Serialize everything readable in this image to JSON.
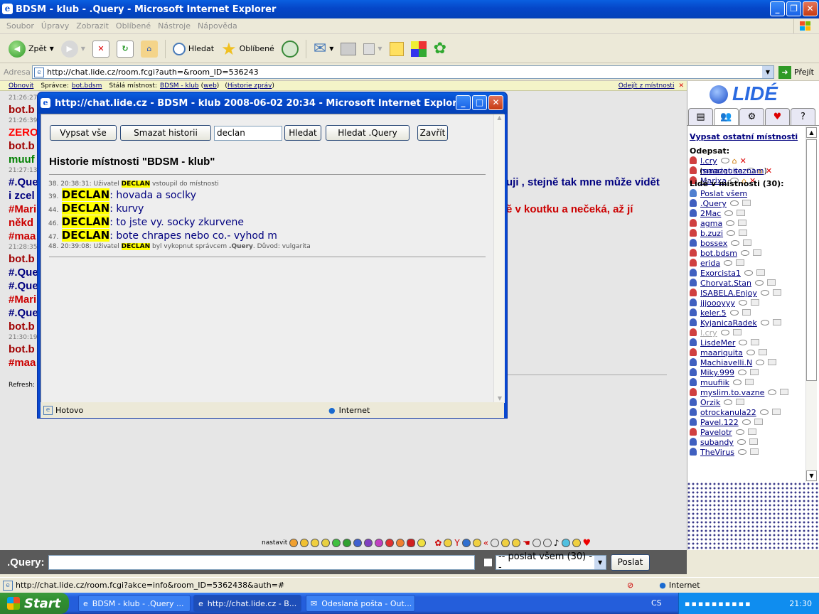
{
  "window": {
    "title": "BDSM - klub - .Query - Microsoft Internet Explorer"
  },
  "menu": [
    "Soubor",
    "Úpravy",
    "Zobrazit",
    "Oblíbené",
    "Nástroje",
    "Nápověda"
  ],
  "toolbar": {
    "back": "Zpět",
    "search": "Hledat",
    "favorites": "Oblíbené"
  },
  "address": {
    "label": "Adresa",
    "url": "http://chat.lide.cz/room.fcgi?auth=&room_ID=536243",
    "go": "Přejít"
  },
  "room_bar": {
    "refresh": "Obnovit",
    "admin_label": "Správce:",
    "admin": "bot.bdsm",
    "room_label": "Stálá místnost:",
    "room": "BDSM - klub",
    "web": "web",
    "history": "Historie zpráv",
    "leave": "Odejít z místnosti"
  },
  "chat": {
    "lines": [
      {
        "text": "21:26:27",
        "color": "#777777",
        "kind": "ts"
      },
      {
        "text": "bot.b",
        "color": "#a00000",
        "kind": "msg"
      },
      {
        "text": "21:26:39",
        "color": "#777777",
        "kind": "ts"
      },
      {
        "text": "ZERO",
        "color": "#ff0000",
        "kind": "msg"
      },
      {
        "text": "bot.b",
        "color": "#a00000",
        "kind": "msg"
      },
      {
        "text": "muuf",
        "color": "#008000",
        "kind": "msg"
      },
      {
        "text": "21:27:13",
        "color": "#777777",
        "kind": "ts"
      },
      {
        "text": "#.Que",
        "color": "#00007f",
        "kind": "msg"
      },
      {
        "text": "i zcel",
        "color": "#00007f",
        "kind": "msg"
      },
      {
        "text": "#Mari",
        "color": "#cc0000",
        "kind": "msg"
      },
      {
        "text": "někd",
        "color": "#cc0000",
        "kind": "msg"
      },
      {
        "text": "#maa",
        "color": "#cc0000",
        "kind": "msg"
      },
      {
        "text": "21:28:35",
        "color": "#777777",
        "kind": "ts"
      },
      {
        "text": "bot.b",
        "color": "#a00000",
        "kind": "msg"
      },
      {
        "text": "#.Que",
        "color": "#00007f",
        "kind": "msg"
      },
      {
        "text": "#.Que",
        "color": "#00007f",
        "kind": "msg"
      },
      {
        "text": "#Mari",
        "color": "#cc0000",
        "kind": "msg"
      },
      {
        "text": "#.Que",
        "color": "#00007f",
        "kind": "msg"
      },
      {
        "text": "bot.b",
        "color": "#a00000",
        "kind": "msg"
      },
      {
        "text": "21:30:19",
        "color": "#777777",
        "kind": "ts"
      },
      {
        "text": "bot.b",
        "color": "#a00000",
        "kind": "msg"
      },
      {
        "text": "#maa",
        "color": "#cc0000",
        "kind": "msg"
      }
    ],
    "right_text_1": "uji , stejně tak mne může vidět",
    "right_text_2": "ě v koutku a nečeká, až jí",
    "refresh_label": "Refresh:",
    "emoticons_label": "nastavit"
  },
  "input": {
    "nick": ".Query:",
    "value": "",
    "send_to": "-- poslat všem (30) --",
    "send": "Poslat"
  },
  "status": {
    "url": "http://chat.lide.cz/room.fcgi?akce=info&room_ID=5362438&auth=#",
    "zone": "Internet"
  },
  "popup": {
    "title": "http://chat.lide.cz - BDSM - klub 2008-06-02 20:34 - Microsoft Internet Explorer",
    "buttons": {
      "all": "Vypsat vše",
      "clear": "Smazat historii",
      "search": "Hledat",
      "search_query": "Hledat .Query",
      "close": "Zavřít"
    },
    "search_value": "declan",
    "heading": "Historie místnosti \"BDSM - klub\"",
    "entries": {
      "e1": {
        "num": "38.",
        "time": "20:38:31:",
        "pre": "Uživatel",
        "nick": "DECLAN",
        "post": "vstoupil do místnosti"
      },
      "e2": {
        "num": "39.",
        "nick": "DECLAN",
        "text": ": hovada a soclky"
      },
      "e3": {
        "num": "44.",
        "nick": "DECLAN",
        "text": ": kurvy"
      },
      "e4": {
        "num": "46.",
        "nick": "DECLAN",
        "text": ": to jste vy. socky zkurvene"
      },
      "e5": {
        "num": "47.",
        "nick": "DECLAN",
        "text": ": bote chrapes nebo co.- vyhod m"
      },
      "e6": {
        "num": "48.",
        "time": "20:39:08:",
        "pre": "Uživatel",
        "nick": "DECLAN",
        "mid": "byl vykopnut správcem",
        "admin": ".Query",
        "reason_label": ". Důvod:",
        "reason": "vulgarita"
      }
    },
    "status_left": "Hotovo",
    "status_zone": "Internet"
  },
  "sidebar": {
    "list_rooms": "Vypsat ostatní místnosti",
    "unsub_label": "Odepsat:",
    "unsub": [
      "l.cry",
      "maariquita",
      "Marixa"
    ],
    "clear_list": "smazat seznam",
    "people_label": "Lidé v místnosti (30):",
    "send_all": "Poslat všem",
    "users": [
      ".Query",
      "2Mac",
      "agma",
      "b.zuzi",
      "bossex",
      "bot.bdsm",
      "erida",
      "Exorcista1",
      "Chorvat.Stan",
      "ISABELA.Enjoy",
      "jjjoooyyy",
      "keler.5",
      "KyjanicaRadek",
      "l.cry",
      "LisdeMer",
      "maariquita",
      "Machiavelli.N",
      "Miky.999",
      "muufiik",
      "myslim.to.vazne",
      "Orzik",
      "otrockanula22",
      "Pavel.122",
      "Pavelotr",
      "subandy",
      "TheVirus"
    ]
  },
  "taskbar": {
    "start": "Start",
    "tasks": [
      "BDSM - klub - .Query ...",
      "http://chat.lide.cz - B...",
      "Odeslaná pošta - Out..."
    ],
    "lang": "CS",
    "clock": "21:30"
  }
}
